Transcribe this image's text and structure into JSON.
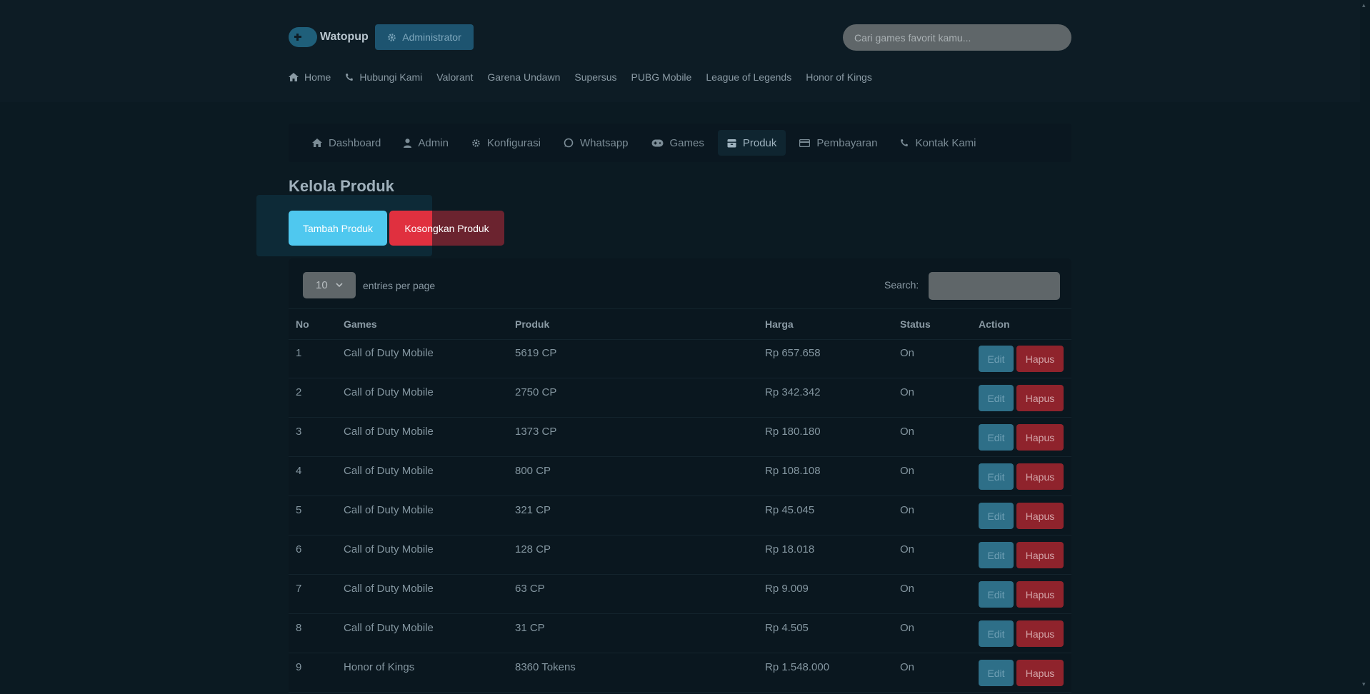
{
  "brand": {
    "logo_text": "Watopup"
  },
  "header": {
    "admin_label": "Administrator",
    "search_placeholder": "Cari games favorit kamu..."
  },
  "main_nav": [
    {
      "label": "Home",
      "icon": "home-icon"
    },
    {
      "label": "Hubungi Kami",
      "icon": "phone-icon"
    },
    {
      "label": "Valorant"
    },
    {
      "label": "Garena Undawn"
    },
    {
      "label": "Supersus"
    },
    {
      "label": "PUBG Mobile"
    },
    {
      "label": "League of Legends"
    },
    {
      "label": "Honor of Kings"
    }
  ],
  "admin_nav": [
    {
      "label": "Dashboard",
      "icon": "home-icon"
    },
    {
      "label": "Admin",
      "icon": "user-icon"
    },
    {
      "label": "Konfigurasi",
      "icon": "gear-icon"
    },
    {
      "label": "Whatsapp",
      "icon": "whatsapp-icon"
    },
    {
      "label": "Games",
      "icon": "gamepad-icon"
    },
    {
      "label": "Produk",
      "icon": "box-icon",
      "active": true
    },
    {
      "label": "Pembayaran",
      "icon": "card-icon"
    },
    {
      "label": "Kontak Kami",
      "icon": "phone-icon"
    }
  ],
  "page": {
    "title": "Kelola Produk",
    "add_button": "Tambah Produk",
    "empty_button": "Kosongkan Produk"
  },
  "table": {
    "entries_value": "10",
    "entries_label": "entries per page",
    "search_label": "Search:",
    "columns": [
      "No",
      "Games",
      "Produk",
      "Harga",
      "Status",
      "Action"
    ],
    "edit_label": "Edit",
    "delete_label": "Hapus",
    "rows": [
      {
        "no": "1",
        "game": "Call of Duty Mobile",
        "product": "5619 CP",
        "price": "Rp 657.658",
        "status": "On"
      },
      {
        "no": "2",
        "game": "Call of Duty Mobile",
        "product": "2750 CP",
        "price": "Rp 342.342",
        "status": "On"
      },
      {
        "no": "3",
        "game": "Call of Duty Mobile",
        "product": "1373 CP",
        "price": "Rp 180.180",
        "status": "On"
      },
      {
        "no": "4",
        "game": "Call of Duty Mobile",
        "product": "800 CP",
        "price": "Rp 108.108",
        "status": "On"
      },
      {
        "no": "5",
        "game": "Call of Duty Mobile",
        "product": "321 CP",
        "price": "Rp 45.045",
        "status": "On"
      },
      {
        "no": "6",
        "game": "Call of Duty Mobile",
        "product": "128 CP",
        "price": "Rp 18.018",
        "status": "On"
      },
      {
        "no": "7",
        "game": "Call of Duty Mobile",
        "product": "63 CP",
        "price": "Rp 9.009",
        "status": "On"
      },
      {
        "no": "8",
        "game": "Call of Duty Mobile",
        "product": "31 CP",
        "price": "Rp 4.505",
        "status": "On"
      },
      {
        "no": "9",
        "game": "Honor of Kings",
        "product": "8360 Tokens",
        "price": "Rp 1.548.000",
        "status": "On"
      }
    ]
  },
  "colors": {
    "background": "#0b1a22",
    "accent_cyan": "#4fc8ef",
    "danger_red": "#e0303f"
  }
}
